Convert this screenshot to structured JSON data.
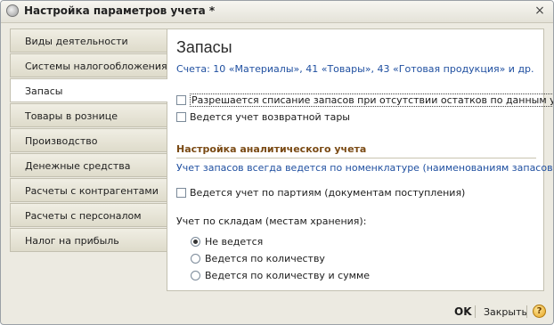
{
  "window": {
    "title": "Настройка параметров учета *",
    "title_icon": "app-icon",
    "close_icon": "×"
  },
  "sidebar": {
    "items": [
      {
        "label": "Виды деятельности"
      },
      {
        "label": "Системы налогообложения"
      },
      {
        "label": "Запасы",
        "active": true
      },
      {
        "label": "Товары в рознице"
      },
      {
        "label": "Производство"
      },
      {
        "label": "Денежные средства"
      },
      {
        "label": "Расчеты с контрагентами"
      },
      {
        "label": "Расчеты с персоналом"
      },
      {
        "label": "Налог на прибыль"
      }
    ]
  },
  "panel": {
    "title": "Запасы",
    "accounts_text": "Счета: 10 «Материалы», 41 «Товары», 43 «Готовая продукция» и др.",
    "cb_write_off": {
      "label": "Разрешается списание запасов при отсутствии остатков по данным учета",
      "checked": false
    },
    "cb_returnable": {
      "label": "Ведется учет возвратной тары",
      "checked": false
    },
    "section_title": "Настройка аналитического учета",
    "section_note": "Учет запасов всегда ведется по номенклатуре (наименованиям запасов)",
    "cb_batches": {
      "label": "Ведется учет по партиям (документам поступления)",
      "checked": false
    },
    "warehouse_label": "Учет по складам (местам хранения):",
    "radio_none": {
      "label": "Не ведется",
      "selected": true
    },
    "radio_qty": {
      "label": "Ведется по количеству",
      "selected": false
    },
    "radio_qty_sum": {
      "label": "Ведется по количеству и сумме",
      "selected": false
    }
  },
  "footer": {
    "ok_label": "OK",
    "close_label": "Закрыть",
    "help_icon": "?"
  },
  "colors": {
    "link_blue": "#1f4fa0",
    "section_brown": "#7a4a14",
    "window_bg": "#eceae1"
  }
}
